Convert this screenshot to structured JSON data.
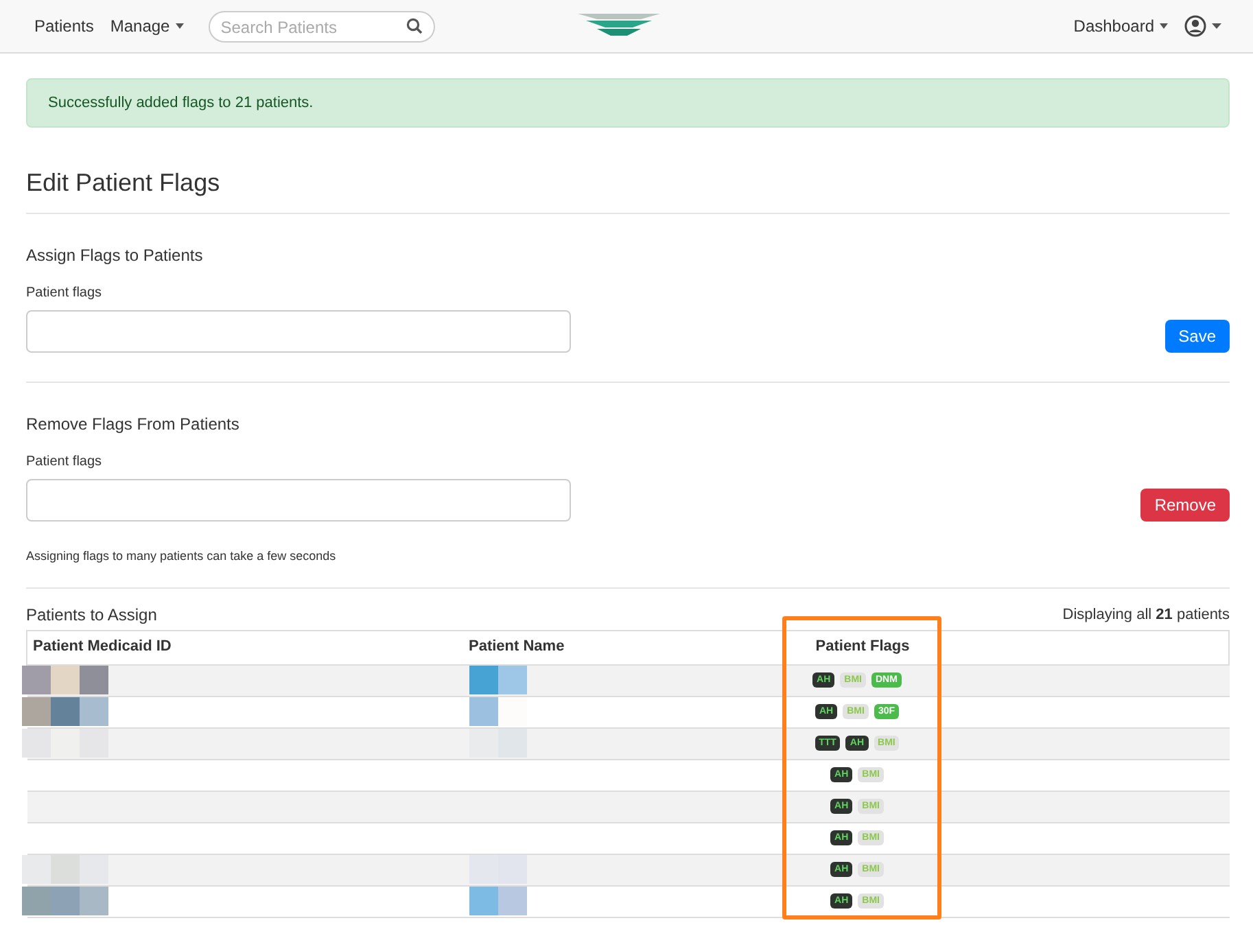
{
  "navbar": {
    "links": [
      {
        "label": "Patients",
        "dropdown": false
      },
      {
        "label": "Manage",
        "dropdown": true
      }
    ],
    "search": {
      "placeholder": "Search Patients"
    },
    "right": {
      "label": "Dashboard"
    }
  },
  "alert": {
    "message": "Successfully added flags to 21 patients."
  },
  "title": "Edit Patient Flags",
  "assign": {
    "heading": "Assign Flags to Patients",
    "label": "Patient flags",
    "button": "Save"
  },
  "remove": {
    "heading": "Remove Flags From Patients",
    "label": "Patient flags",
    "button": "Remove",
    "note": "Assigning flags to many patients can take a few seconds"
  },
  "patients": {
    "heading": "Patients to Assign",
    "summary": "Displaying all **21** patients",
    "columns": [
      "Patient Medicaid ID",
      "Patient Name",
      "Patient Flags"
    ],
    "rows": [
      {
        "flags": [
          {
            "label": "AH",
            "kind": "dark"
          },
          {
            "label": "BMI",
            "kind": "light"
          },
          {
            "label": "DNM",
            "kind": "green"
          }
        ]
      },
      {
        "flags": [
          {
            "label": "AH",
            "kind": "dark"
          },
          {
            "label": "BMI",
            "kind": "light"
          },
          {
            "label": "30F",
            "kind": "green"
          }
        ]
      },
      {
        "flags": [
          {
            "label": "TTT",
            "kind": "dark"
          },
          {
            "label": "AH",
            "kind": "dark"
          },
          {
            "label": "BMI",
            "kind": "light"
          }
        ]
      },
      {
        "flags": [
          {
            "label": "AH",
            "kind": "dark"
          },
          {
            "label": "BMI",
            "kind": "light"
          }
        ]
      },
      {
        "flags": [
          {
            "label": "AH",
            "kind": "dark"
          },
          {
            "label": "BMI",
            "kind": "light"
          }
        ]
      },
      {
        "flags": [
          {
            "label": "AH",
            "kind": "dark"
          },
          {
            "label": "BMI",
            "kind": "light"
          }
        ]
      },
      {
        "flags": [
          {
            "label": "AH",
            "kind": "dark"
          },
          {
            "label": "BMI",
            "kind": "light"
          }
        ]
      },
      {
        "flags": [
          {
            "label": "AH",
            "kind": "dark"
          },
          {
            "label": "BMI",
            "kind": "light"
          }
        ]
      }
    ]
  }
}
